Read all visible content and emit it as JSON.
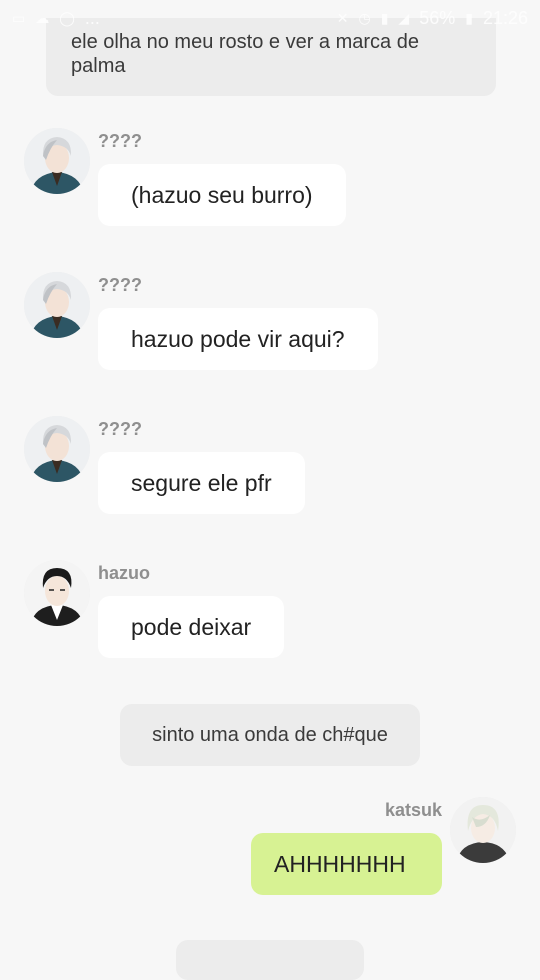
{
  "statusbar": {
    "left_text": "...",
    "battery": "56%",
    "time": "21:26"
  },
  "narration_top": "ele olha no meu rosto e ver a marca de palma",
  "messages": [
    {
      "sender": "????",
      "text": "(hazuo seu burro)",
      "avatar": "silver-hair-character-avatar"
    },
    {
      "sender": "????",
      "text": "hazuo pode vir aqui?",
      "avatar": "silver-hair-character-avatar"
    },
    {
      "sender": "????",
      "text": "segure ele pfr",
      "avatar": "silver-hair-character-avatar"
    },
    {
      "sender": "hazuo",
      "text": "pode deixar",
      "avatar": "dark-hair-character-avatar"
    }
  ],
  "narration_mid": "sinto uma onda de ch#que",
  "self_message": {
    "sender": "katsuk",
    "text": "AHHHHHHH",
    "avatar": "pale-hair-character-avatar"
  },
  "colors": {
    "background": "#f7f7f7",
    "bubble": "#ffffff",
    "self_bubble": "#d7f293",
    "narration": "#ececec",
    "name": "#8f8f8f"
  }
}
